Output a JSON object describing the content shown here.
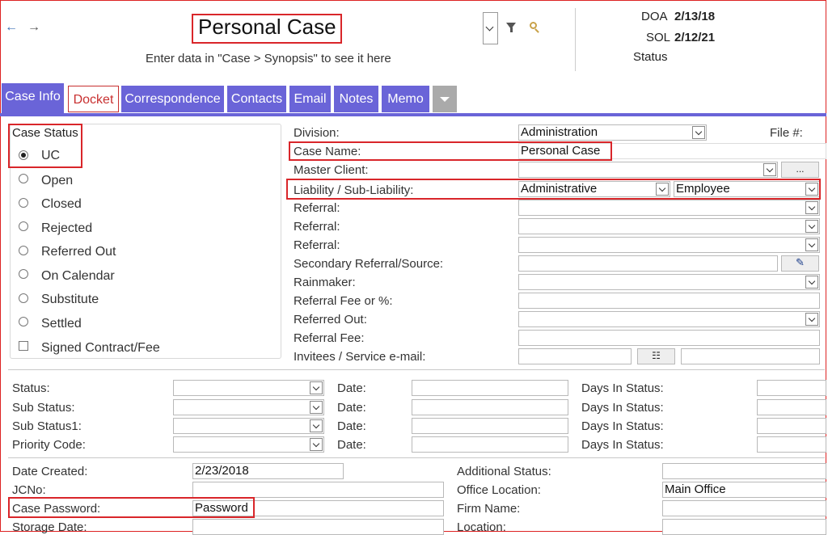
{
  "header": {
    "title": "Personal Case",
    "synopsis": "Enter data in \"Case > Synopsis\" to see it here",
    "doa_label": "DOA",
    "doa_value": "2/13/18",
    "sol_label": "SOL",
    "sol_value": "2/12/21",
    "status_label": "Status"
  },
  "tabs": [
    "Case Info",
    "Docket",
    "Correspondence",
    "Contacts",
    "Email",
    "Notes",
    "Memo"
  ],
  "case_status": {
    "title": "Case Status",
    "options": [
      "UC",
      "Open",
      "Closed",
      "Rejected",
      "Referred Out",
      "On Calendar",
      "Substitute",
      "Settled"
    ],
    "selected": "UC",
    "checkbox_label": "Signed Contract/Fee"
  },
  "right_form": {
    "division_label": "Division:",
    "division_value": "Administration",
    "file_label": "File #:",
    "case_name_label": "Case Name:",
    "case_name_value": "Personal Case",
    "master_client_label": "Master Client:",
    "master_client_btn": "...",
    "liability_label": "Liability / Sub-Liability:",
    "liability_value": "Administrative",
    "sub_liability_value": "Employee",
    "referral1_label": "Referral:",
    "referral2_label": "Referral:",
    "referral3_label": "Referral:",
    "secondary_referral_label": "Secondary Referral/Source:",
    "rainmaker_label": "Rainmaker:",
    "referral_fee_pct_label": "Referral Fee or %:",
    "referred_out_label": "Referred Out:",
    "referral_fee_label": "Referral Fee:",
    "invitees_label": "Invitees / Service e-mail:"
  },
  "status_rows": [
    {
      "label": "Status:",
      "date_label": "Date:",
      "days_label": "Days In Status:"
    },
    {
      "label": "Sub Status:",
      "date_label": "Date:",
      "days_label": "Days In Status:"
    },
    {
      "label": "Sub Status1:",
      "date_label": "Date:",
      "days_label": "Days In Status:"
    },
    {
      "label": "Priority Code:",
      "date_label": "Date:",
      "days_label": "Days In Status:"
    }
  ],
  "bottom": {
    "date_created_label": "Date Created:",
    "date_created_value": "2/23/2018",
    "jcno_label": "JCNo:",
    "password_label": "Case Password:",
    "password_value": "Password",
    "storage_label": "Storage Date:",
    "additional_status_label": "Additional Status:",
    "office_location_label": "Office Location:",
    "office_location_value": "Main Office",
    "firm_name_label": "Firm Name:",
    "location_label": "Location:"
  },
  "colors": {
    "tab": "#6a64d8",
    "highlight": "#d9262a",
    "nav_arrow": "#3a6fb5"
  }
}
